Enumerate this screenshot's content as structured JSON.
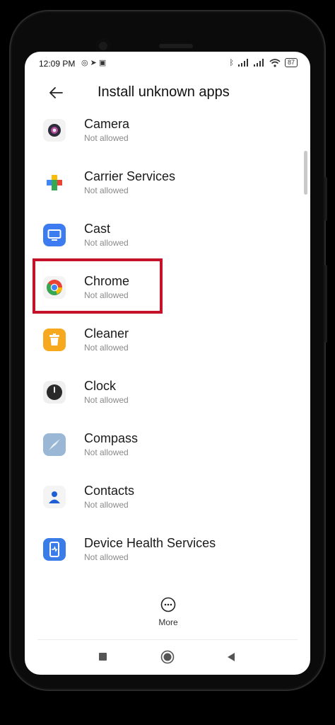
{
  "status_bar": {
    "time": "12:09 PM",
    "left_icons": [
      "whatsapp-icon",
      "telegram-icon",
      "screen-icon"
    ],
    "right_icons": [
      "bluetooth-icon",
      "signal-icon",
      "signal-icon",
      "wifi-icon"
    ],
    "battery": "87"
  },
  "header": {
    "title": "Install unknown apps"
  },
  "apps": [
    {
      "name": "Camera",
      "status": "Not allowed",
      "icon": "camera-icon"
    },
    {
      "name": "Carrier Services",
      "status": "Not allowed",
      "icon": "carrier-services-icon"
    },
    {
      "name": "Cast",
      "status": "Not allowed",
      "icon": "cast-icon"
    },
    {
      "name": "Chrome",
      "status": "Not allowed",
      "icon": "chrome-icon"
    },
    {
      "name": "Cleaner",
      "status": "Not allowed",
      "icon": "cleaner-icon"
    },
    {
      "name": "Clock",
      "status": "Not allowed",
      "icon": "clock-icon"
    },
    {
      "name": "Compass",
      "status": "Not allowed",
      "icon": "compass-icon"
    },
    {
      "name": "Contacts",
      "status": "Not allowed",
      "icon": "contacts-icon"
    },
    {
      "name": "Device Health Services",
      "status": "Not allowed",
      "icon": "device-health-icon"
    }
  ],
  "more": {
    "label": "More"
  },
  "highlight_color": "#c4122b"
}
